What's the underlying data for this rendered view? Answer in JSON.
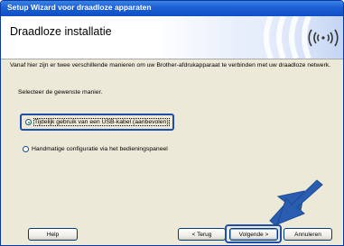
{
  "window": {
    "title": "Setup Wizard voor draadloze apparaten",
    "header_title": "Draadloze installatie"
  },
  "content": {
    "intro": "Vanaf hier zijn er twee verschillende manieren om uw Brother-afdrukapparaat te verbinden met uw draadloze netwerk.",
    "select_label": "Selecteer de gewenste manier.",
    "options": [
      {
        "label": "Tijdelijk gebruik van een USB-kabel (aanbevolen)",
        "selected": true
      },
      {
        "label": "Handmatige configuratie via het bedieningspaneel",
        "selected": false
      }
    ]
  },
  "buttons": {
    "help": "Help",
    "back": "< Terug",
    "next": "Volgende >",
    "cancel": "Annuleren"
  },
  "colors": {
    "titlebar": "#1c5fd4",
    "highlight": "#1e4ea8",
    "arrow": "#2a5db0",
    "dialog_bg": "#ece9d8"
  },
  "icons": {
    "header_logo": "wireless-waves-icon",
    "pointer": "pointer-arrow-icon"
  }
}
